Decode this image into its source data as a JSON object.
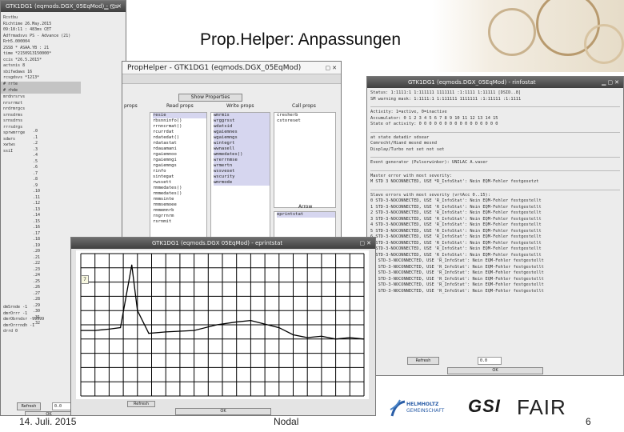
{
  "slide": {
    "title": "Prop.Helper: Anpassungen",
    "footer_date": "14. Juli. 2015",
    "footer_center": "Nodal",
    "page_number": "6",
    "logo_helmholtz_line1": "HELMHOLTZ",
    "logo_helmholtz_line2": "GEMEINSCHAFT",
    "logo_gsi": "GSI",
    "logo_fair": "FAIR"
  },
  "rcs_window": {
    "title": "GTK1DG1 (eqmods.DGX_05EqMod) - rcs",
    "rows": [
      "Rcstbu",
      "Richtime  26.May.2015",
      "        09:18:11 : 483ms CET",
      "Adfrmadsvs  PS - Advance (21)",
      "        Rrh5.000004",
      "          2SS8 * ASAA.YB : 21",
      "time  *2150913150000*",
      "ccis  *26.5.2015*",
      "actsnis   8",
      "sbifwdaws  16",
      "rcsgdsvs  *1213*"
    ],
    "sel1": "# rrte",
    "sel2": "# rhde",
    "rows2": [
      "mrdnrsrvs",
      "nrsrrmzt",
      "nrdrmrgcs",
      "srnsdrms",
      "srnsdrns",
      "rrrsdrgs",
      "sprwmrrge",
      "sdwrs",
      "xwtws",
      "ssiI"
    ],
    "indices": [
      ".0",
      ".1",
      ".2",
      ".3",
      ".4",
      ".5",
      ".6",
      ".7",
      ".8",
      ".9",
      ".10",
      ".11",
      ".12",
      ".13",
      ".14",
      ".15",
      ".16",
      ".17",
      ".18",
      ".19",
      ".20",
      ".21",
      ".22",
      ".23",
      ".24",
      ".25",
      ".26",
      ".27",
      ".28",
      ".29",
      ".30",
      ".31",
      ".32"
    ],
    "bottom_rows": [
      "dmSrnde   -1",
      "dmrOrrr   -1",
      "dmrObrndsr  -99999",
      "dmrOrrrndh  -1",
      "drrd   0"
    ],
    "refresh_label": "Refresh",
    "refresh_value": "0.0",
    "ok_label": "OK"
  },
  "prophelper_window": {
    "title": "PropHelper - GTK1DG1 (eqmods.DGX_05EqMod)",
    "show_properties": "Show Properties",
    "col_props": "props",
    "col_read": "Read props",
    "col_write": "Write props",
    "col_call": "Call props",
    "read_props": [
      "resie",
      "rbsnninfo()",
      "rrnncrmat()",
      "rcurrdat",
      "rdatedat()",
      "rdatastat",
      "rdauamani",
      "rgaiemnoo",
      "rgaiemngi",
      "rgaiemngs",
      "rinfo",
      "sintegat",
      "rwssett",
      "rmmedates()",
      "rmmedates()",
      "rmmsinte",
      "rmmsemoee",
      "rmmemnrb",
      "rngrrnrm",
      "rsrnmit"
    ],
    "write_props": [
      "wmrmis",
      "wrggrsst",
      "wdatsid",
      "wgaiemnes",
      "wgaiemngs",
      "wintegrt",
      "wwnasell",
      "wmmedates()",
      "wrerrnmse",
      "wrmertn",
      "wssveset",
      "wscurity",
      "wmrmode"
    ],
    "call_props": [
      "cresherb",
      "cstoreset"
    ],
    "arrow_label": "Arrow",
    "arrow_item": "eprintstat"
  },
  "infostat_window": {
    "title": "GTK1DG1 (eqmods.DGX_05EqMod) - rinfostat",
    "header_rows": [
      "Status:      1:1111:1 1:111111 1111111 :1:1111 1:11111  [DSID..8]",
      "SM warning mask: 1:1111:1 1:111111 1111111 :1:11111 :1:1111"
    ],
    "activity_label": "Activity: 1=active, 0=inactive",
    "accumulator_row": "Accumulator:        0  1  2  3  4  5  6  7  8  9  10  11  12  13  14  15",
    "state_row": "State of activity:   0  0  0  0  0  0  0  0  0  0   0   0   0   0   0   0",
    "mode_rows": [
      "at state                          datadir  sdsear",
      "Comrecht/Hiand                    mesnd    mesnd",
      "Display/Turbo                     not set  not set"
    ],
    "event_row": "Event generator (Pulserwinker):  UNILAC A.vaser",
    "master_label": "Master error with most severity:",
    "master_error": "  M    STD 3 NOCONNECTED, USE *R_InfoStat': Nein EQM-Fehler festgesetzt",
    "slave_label": "Slave errors with most severity (vrtAcc 0..15):",
    "slave_rows": [
      "  0   STD-3-NOCONNECTED, USE 'R_InfoStat': Nein EQM-Fehler festgestellt",
      "  1   STD-3-NOCONNECTED, USE 'R_InfoStat': Nein EQM-Fehler festgestellt",
      "  2   STD-3-NOCONNECTED, USE 'R_InfoStat': Nein EQM-Fehler festgestellt",
      "  3   STD-3-NOCONNECTED, USE 'R_InfoStat': Nein EQM-Fehler festgestellt",
      "  4   STD-3-NOCONNECTED, USE 'R_InfoStat': Nein EQM-Fehler festgestellt",
      "  5   STD-3-NOCONNECTED, USE 'R_InfoStat': Nein EQM-Fehler festgestellt",
      "  6   STD-3-NOCONNECTED, USE 'R_InfoStat': Nein EQM-Fehler festgestellt",
      "  7   STD-3-NOCONNECTED, USE 'R_InfoStat': Nein EQM-Fehler festgestellt",
      "  8   STD-3-NOCONNECTED, USE 'R_InfoStat': Nein EQM-Fehler festgestellt",
      "  9   STD-3-NOCONNECTED, USE 'R_InfoStat': Nein EQM-Fehler festgestellt",
      "  10  STD-3-NOCONNECTED, USE 'R_InfoStat': Nein EQM-Fehler festgestellt",
      "  11  STD-3-NOCONNECTED, USE 'R_InfoStat': Nein EQM-Fehler festgestellt",
      "  12  STD-3-NOCONNECTED, USE 'R_InfoStat': Nein EQM-Fehler festgestellt",
      "  13  STD-3-NOCONNECTED, USE 'R_InfoStat': Nein EQM-Fehler festgestellt",
      "  14  STD-3-NOCONNECTED, USE 'R_InfoStat': Nein EQM-Fehler festgestellt",
      "  15  STD-3-NOCONNECTED, USE 'R_InfoStat': Nein EQM-Fehler festgestellt"
    ],
    "refresh_label": "Refresh",
    "refresh_value": "0.0",
    "ok_label": "OK"
  },
  "eprintstat_window": {
    "title": "GTK1DG1 (eqmods.DGX 05EqMod) - eprintstat",
    "marker_label": "7",
    "refresh_label": "Refresh",
    "ok_label": "OK"
  },
  "chart_data": {
    "type": "line",
    "series": [
      {
        "x": [
          0,
          5,
          10,
          14,
          16,
          18,
          20,
          24,
          30,
          40,
          48,
          55,
          60,
          64,
          70,
          75,
          80,
          85,
          90,
          95,
          100
        ],
        "y": [
          46,
          46,
          47,
          48,
          70,
          92,
          60,
          44,
          45,
          46,
          50,
          52,
          53,
          51,
          48,
          43,
          41,
          42,
          40,
          41,
          40
        ]
      }
    ],
    "xlim": [
      0,
      100
    ],
    "ylim": [
      0,
      100
    ],
    "grid": true
  },
  "colors": {
    "titlebar": "#4a4a4a",
    "window_bg": "#ececec",
    "selection": "#d6d6ef",
    "plot_line": "#000000",
    "plot_grid": "#000000"
  }
}
